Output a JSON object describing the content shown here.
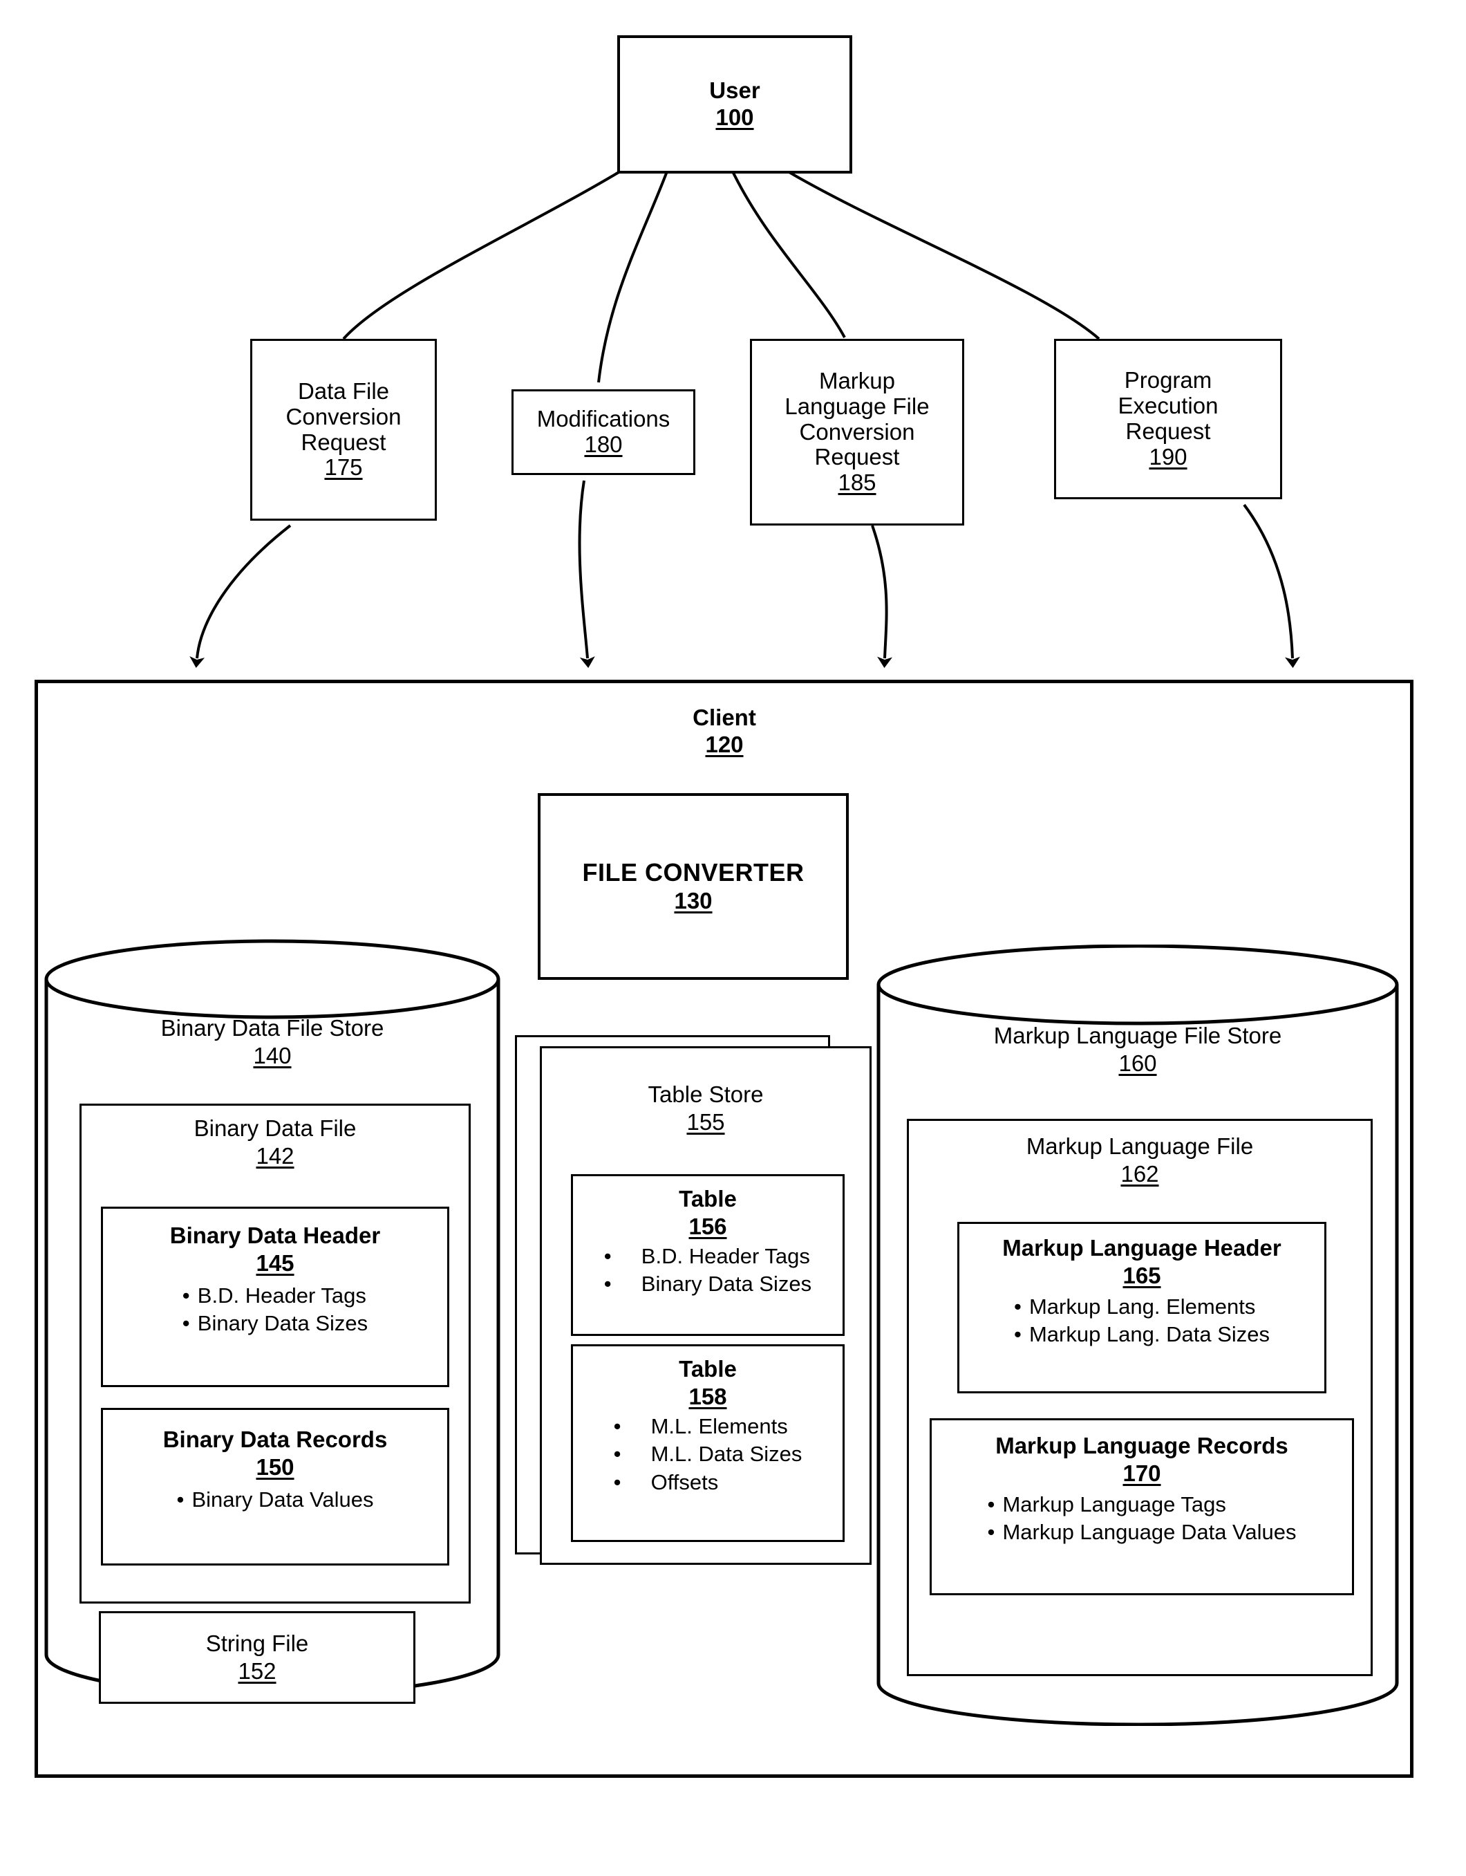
{
  "figure": {
    "user": {
      "title": "User",
      "number": "100"
    },
    "requests": [
      {
        "lines": [
          "Data File",
          "Conversion",
          "Request"
        ],
        "number": "175"
      },
      {
        "lines": [
          "Modifications"
        ],
        "number": "180"
      },
      {
        "lines": [
          "Markup",
          "Language File",
          "Conversion",
          "Request"
        ],
        "number": "185"
      },
      {
        "lines": [
          "Program",
          "Execution",
          "Request"
        ],
        "number": "190"
      }
    ],
    "client": {
      "title": "Client",
      "number": "120"
    },
    "file_converter": {
      "title": "FILE CONVERTER",
      "number": "130"
    },
    "binary_store": {
      "title": "Binary Data File Store",
      "number": "140",
      "file": {
        "title": "Binary Data File",
        "number": "142"
      },
      "header": {
        "title": "Binary Data Header",
        "number": "145",
        "items": [
          "B.D. Header Tags",
          "Binary Data Sizes"
        ]
      },
      "records": {
        "title": "Binary Data Records",
        "number": "150",
        "items": [
          "Binary Data Values"
        ]
      },
      "string_file": {
        "title": "String File",
        "number": "152"
      }
    },
    "table_store": {
      "title": "Table Store",
      "number": "155",
      "tables": [
        {
          "title": "Table",
          "number": "156",
          "items": [
            "B.D. Header Tags",
            "Binary Data Sizes"
          ]
        },
        {
          "title": "Table",
          "number": "158",
          "items": [
            "M.L. Elements",
            "M.L. Data Sizes",
            "Offsets"
          ]
        }
      ]
    },
    "markup_store": {
      "title": "Markup Language File Store",
      "number": "160",
      "file": {
        "title": "Markup Language File",
        "number": "162"
      },
      "header": {
        "title": "Markup Language Header",
        "number": "165",
        "items": [
          "Markup Lang. Elements",
          "Markup Lang. Data Sizes"
        ]
      },
      "records": {
        "title": "Markup Language Records",
        "number": "170",
        "items": [
          "Markup Language Tags",
          "Markup Language Data Values"
        ]
      }
    },
    "colors": {
      "ink": "#000000",
      "paper": "#ffffff"
    }
  }
}
